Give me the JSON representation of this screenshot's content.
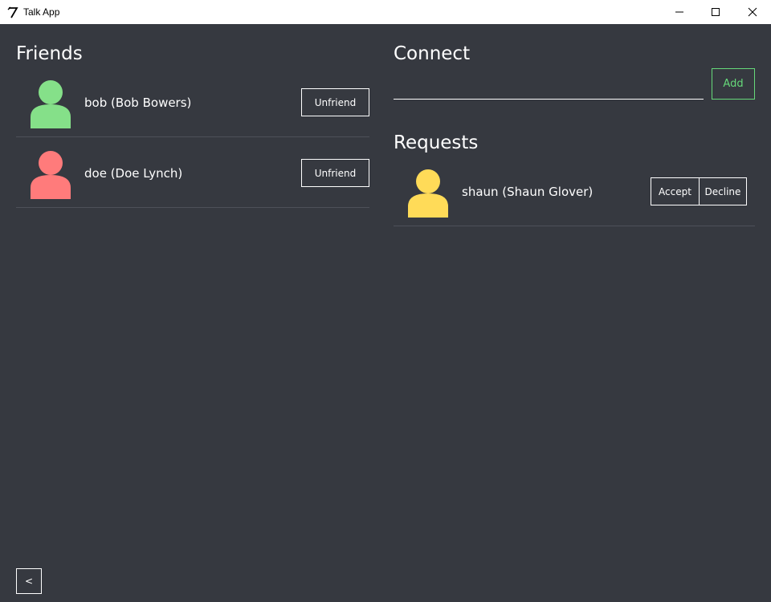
{
  "window": {
    "title": "Talk App",
    "minimize_icon": "minimize-icon",
    "maximize_icon": "maximize-icon",
    "close_icon": "close-icon"
  },
  "friends": {
    "heading": "Friends",
    "items": [
      {
        "name": "bob (Bob Bowers)",
        "avatar_color": "#85e089",
        "action_label": "Unfriend"
      },
      {
        "name": "doe (Doe Lynch)",
        "avatar_color": "#ff7b7b",
        "action_label": "Unfriend"
      }
    ]
  },
  "connect": {
    "heading": "Connect",
    "input_value": "",
    "input_placeholder": "",
    "add_label": "Add",
    "add_color": "#66d97a"
  },
  "requests": {
    "heading": "Requests",
    "items": [
      {
        "name": "shaun (Shaun Glover)",
        "avatar_color": "#ffdb58",
        "accept_label": "Accept",
        "decline_label": "Decline"
      }
    ]
  },
  "footer": {
    "back_label": "<"
  },
  "colors": {
    "background": "#363940",
    "text": "#ffffff",
    "divider": "#4e5159"
  }
}
